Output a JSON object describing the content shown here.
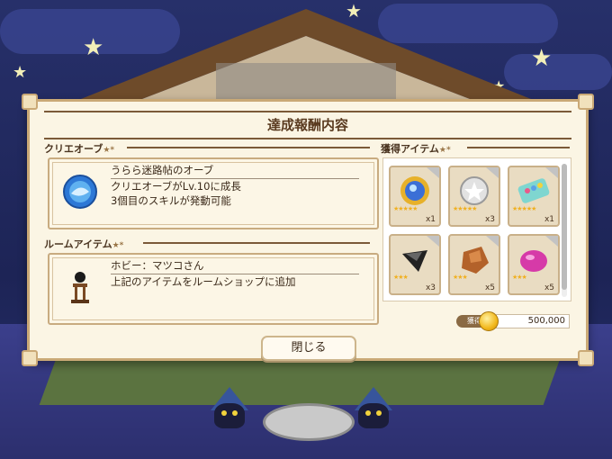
{
  "dialog": {
    "title": "達成報酬内容",
    "close_label": "閉じる"
  },
  "crieorb": {
    "header": "クリエオーブ",
    "header_deco": "★*",
    "line1": "うらら迷路帖のオーブ",
    "line2": "クリエオーブがLv.10に成長",
    "line3": "3個目のスキルが発動可能",
    "icon": "blue-orb-icon"
  },
  "room_item": {
    "header": "ルームアイテム",
    "header_deco": "★*",
    "line1": "ホビー：マツコさん",
    "line2": "上記のアイテムをルームショップに追加",
    "icon": "matsuko-figure-icon"
  },
  "acquired": {
    "header": "獲得アイテム",
    "header_deco": "★*",
    "items": [
      {
        "icon": "gold-orb-item-icon",
        "count": "x1",
        "rarity": 5
      },
      {
        "icon": "silver-medal-item-icon",
        "count": "x3",
        "rarity": 5
      },
      {
        "icon": "gem-tray-item-icon",
        "count": "x1",
        "rarity": 5
      },
      {
        "icon": "black-stone-item-icon",
        "count": "x3",
        "rarity": 3
      },
      {
        "icon": "copper-ore-item-icon",
        "count": "x5",
        "rarity": 3
      },
      {
        "icon": "pink-gem-item-icon",
        "count": "x5",
        "rarity": 3
      }
    ],
    "currency_label": "獲得",
    "currency_value": "500,000",
    "currency_icon": "gold-coin-icon"
  },
  "colors": {
    "panel_bg": "#fbf5e4",
    "panel_border": "#caa976",
    "title_text": "#5a3b20",
    "night_sky": "#1e2450"
  }
}
